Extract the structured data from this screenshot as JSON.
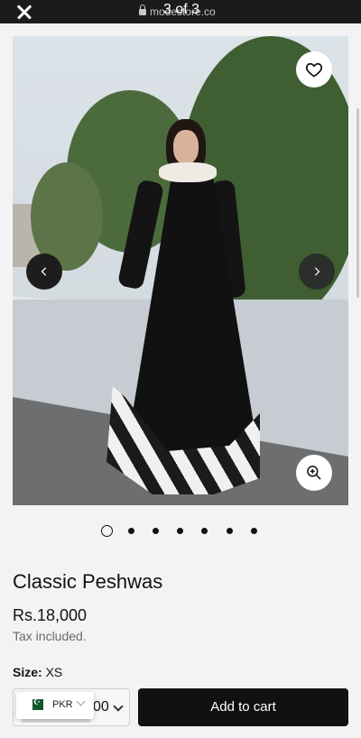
{
  "browser": {
    "url": "modestore.co",
    "image_counter": "3 of 3"
  },
  "gallery": {
    "dot_count": 7,
    "active_index": 0
  },
  "product": {
    "title": "Classic Peshwas",
    "price": "Rs.18,000",
    "tax_note": "Tax included.",
    "size_label": "Size:",
    "size_value": "XS"
  },
  "purchase": {
    "quantity_partial": "00",
    "add_to_cart": "Add to cart"
  },
  "currency": {
    "code": "PKR",
    "flag": "pakistan-flag-icon"
  },
  "colors": {
    "topbar": "#1b1b1b",
    "button_dark": "#111111",
    "background": "#f3f3f3"
  }
}
